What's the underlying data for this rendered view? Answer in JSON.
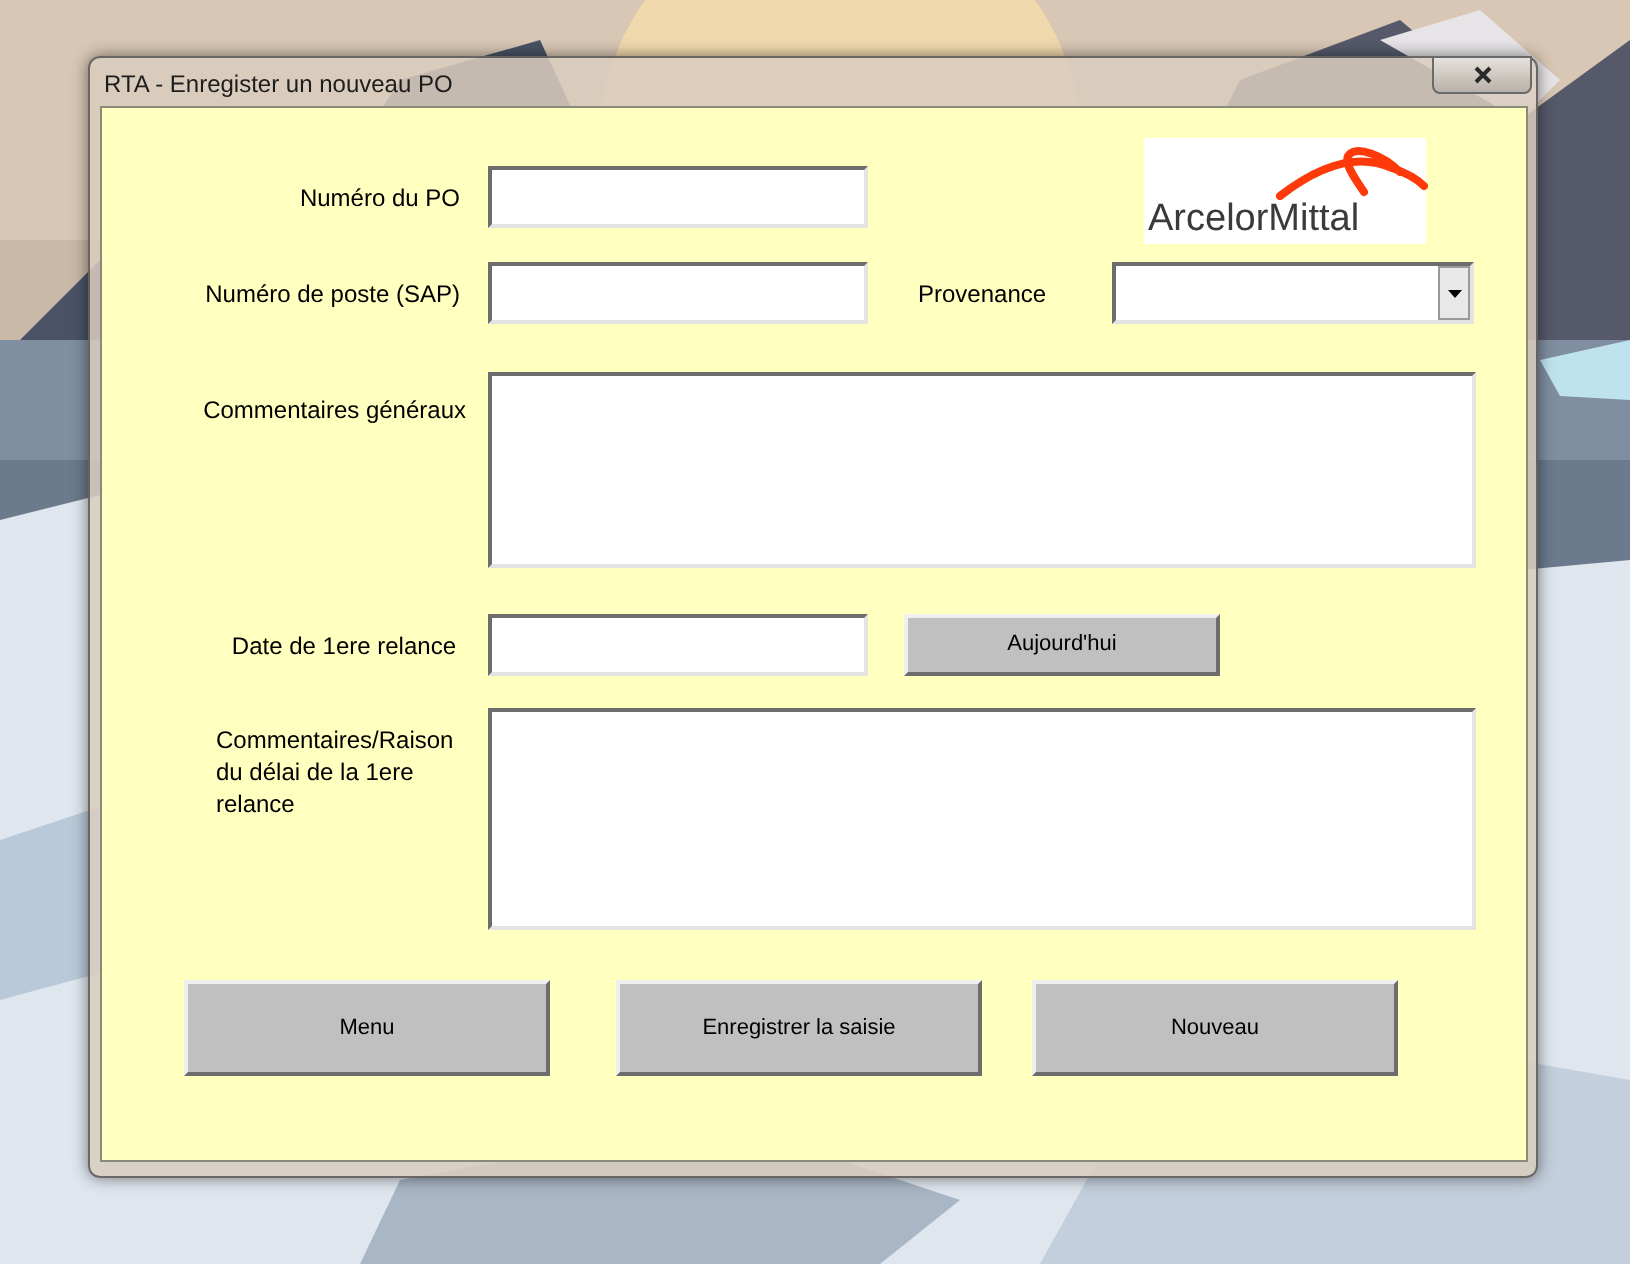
{
  "window": {
    "title": "RTA - Enregister un nouveau PO"
  },
  "logo": {
    "text": "ArcelorMittal"
  },
  "po_number": {
    "label": "Numéro du PO"
  },
  "post_number": {
    "label": "Numéro de poste (SAP)"
  },
  "provenance": {
    "label": "Provenance"
  },
  "general_comments": {
    "label": "Commentaires généraux"
  },
  "first_reminder_date": {
    "label": "Date de 1ere relance",
    "button": "Aujourd'hui"
  },
  "reminder_comments": {
    "label": "Commentaires/Raison du délai de la 1ere relance"
  },
  "buttons": [
    "Menu",
    "Enregistrer la saisie",
    "Nouveau"
  ]
}
